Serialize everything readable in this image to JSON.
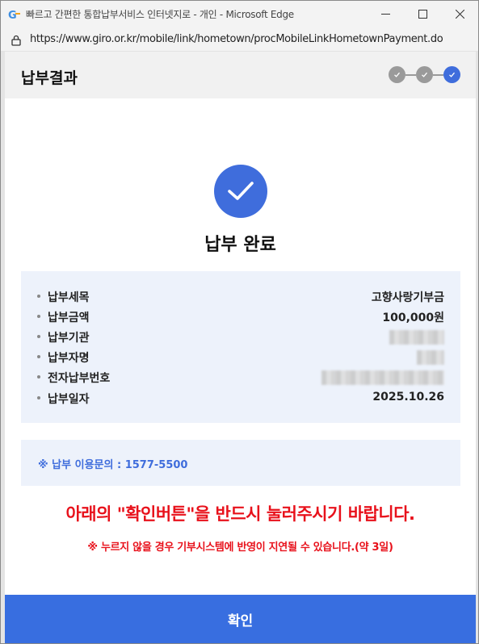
{
  "window": {
    "title": "빠르고 간편한 통합납부서비스 인터넷지로 - 개인 - Microsoft Edge",
    "favicon": "giro-logo-icon",
    "controls": [
      "minimize-icon",
      "maximize-icon",
      "close-icon"
    ]
  },
  "address_bar": {
    "url": "https://www.giro.or.kr/mobile/link/hometown/procMobileLinkHometownPayment.do",
    "security_icon": "lock-icon"
  },
  "header": {
    "title": "납부결과",
    "steps": [
      {
        "state": "done",
        "color": "#9a9a9a"
      },
      {
        "state": "done",
        "color": "#9a9a9a"
      },
      {
        "state": "current",
        "color": "#3f6ddc"
      }
    ]
  },
  "result": {
    "icon": "check-icon",
    "title": "납부 완료"
  },
  "details": [
    {
      "label": "납부세목",
      "value": "고향사랑기부금",
      "redacted": false
    },
    {
      "label": "납부금액",
      "value": "100,000원",
      "redacted": false
    },
    {
      "label": "납부기관",
      "value": "",
      "redacted": true
    },
    {
      "label": "납부자명",
      "value": "",
      "redacted": true
    },
    {
      "label": "전자납부번호",
      "value": "",
      "redacted": true
    },
    {
      "label": "납부일자",
      "value": "2025.10.26",
      "redacted": false
    }
  ],
  "contact": {
    "text": "※ 납부 이용문의 : 1577-5500"
  },
  "notice": {
    "main": "아래의 \"확인버튼\"을 반드시 눌러주시기 바랍니다.",
    "sub": "※ 누르지 않을 경우 기부시스템에 반영이 지연될 수 있습니다.(약 3일)"
  },
  "confirm_button": {
    "label": "확인"
  },
  "colors": {
    "accent": "#3f6ddc",
    "button": "#386ee0",
    "warning": "#e8111b",
    "panel": "#edf2fb"
  }
}
